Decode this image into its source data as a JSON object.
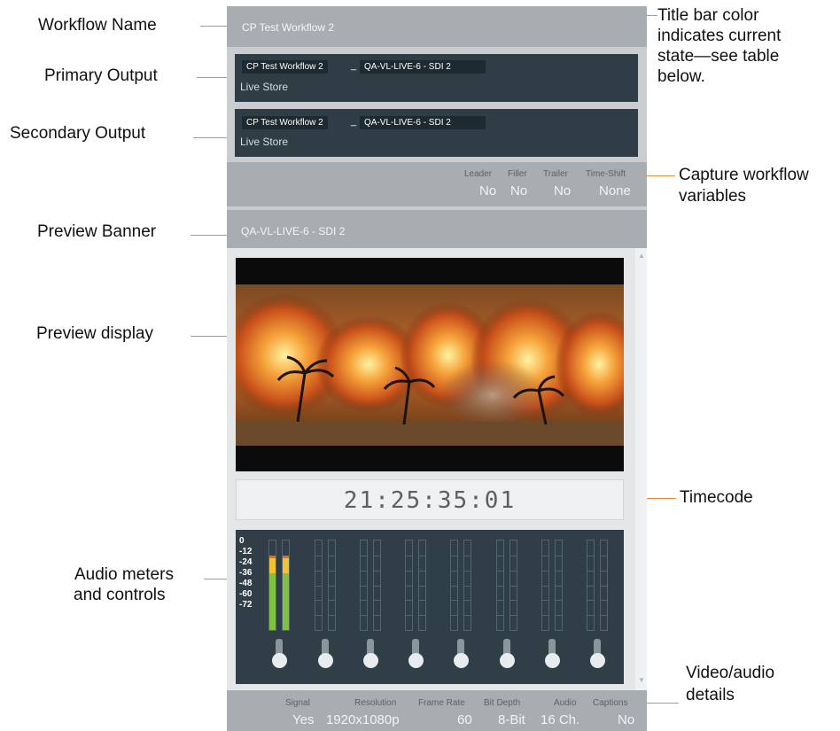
{
  "callouts": {
    "workflow_name": "Workflow Name",
    "primary_output": "Primary Output",
    "secondary_output": "Secondary Output",
    "preview_banner": "Preview Banner",
    "preview_display": "Preview display",
    "audio_meters_1": "Audio meters",
    "audio_meters_2": "and controls",
    "title_bar_1": "Title bar color",
    "title_bar_2": "indicates current",
    "title_bar_3": "state—see table",
    "title_bar_4": "below.",
    "capture_1": "Capture workflow",
    "capture_2": "variables",
    "timecode": "Timecode",
    "details_1": "Video/audio",
    "details_2": "details"
  },
  "panel": {
    "workflow_title": "CP Test Workflow 2",
    "primary": {
      "workflow": "CP Test Workflow 2",
      "separator": "_",
      "source": "QA-VL-LIVE-6 - SDI 2",
      "store": "Live Store"
    },
    "secondary": {
      "workflow": "CP Test Workflow 2",
      "separator": "_",
      "source": "QA-VL-LIVE-6 - SDI 2",
      "store": "Live Store"
    },
    "variables": {
      "leader_label": "Leader",
      "leader_value": "No",
      "filler_label": "Filler",
      "filler_value": "No",
      "trailer_label": "Trailer",
      "trailer_value": "No",
      "timeshift_label": "Time-Shift",
      "timeshift_value": "None"
    },
    "preview_banner": "QA-VL-LIVE-6 - SDI 2",
    "timecode": "21:25:35:01",
    "audio": {
      "db_scale": [
        "0",
        "-12",
        "-24",
        "-36",
        "-48",
        "-60",
        "-72"
      ],
      "channel_levels_db": [
        -12,
        -12,
        null,
        null,
        null,
        null,
        null,
        null,
        null,
        null,
        null,
        null,
        null,
        null,
        null,
        null
      ],
      "colors": {
        "green": "#7fc241",
        "yellow": "#f1c232",
        "red": "#e06c2a",
        "background": "#2f3e47"
      }
    },
    "details": {
      "signal_label": "Signal",
      "signal_value": "Yes",
      "resolution_label": "Resolution",
      "resolution_value": "1920x1080p",
      "framerate_label": "Frame Rate",
      "framerate_value": "60",
      "bitdepth_label": "Bit Depth",
      "bitdepth_value": "8-Bit",
      "audio_label": "Audio",
      "audio_value": "16 Ch.",
      "captions_label": "Captions",
      "captions_value": "No"
    },
    "colors": {
      "callout_line": "#e88a3a",
      "title_bar": "#a8adb1",
      "output_box": "#2e3d46"
    }
  }
}
